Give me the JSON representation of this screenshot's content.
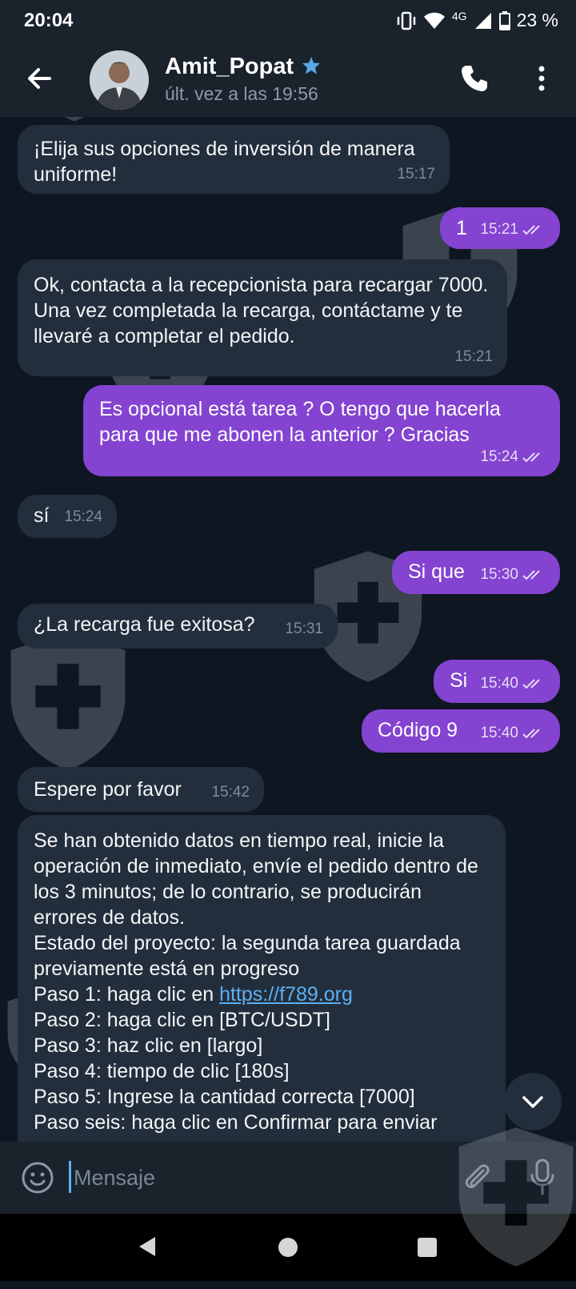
{
  "status_bar": {
    "time": "20:04",
    "network": "4G",
    "battery": "23 %"
  },
  "header": {
    "contact_name": "Amit_Popat",
    "last_seen": "últ. vez a las 19:56"
  },
  "messages": [
    {
      "dir": "in",
      "text": "¡Elija sus opciones de inversión de manera uniforme!",
      "time": "15:17"
    },
    {
      "dir": "out",
      "text": "1",
      "time": "15:21",
      "read": true
    },
    {
      "dir": "in",
      "text": "Ok, contacta a la recepcionista para recargar 7000. Una vez completada la recarga, contáctame y te llevaré a completar el pedido.",
      "time": "15:21"
    },
    {
      "dir": "out",
      "text": "Es opcional está tarea ? O tengo que hacerla para que me abonen la anterior ? Gracias",
      "time": "15:24",
      "read": true
    },
    {
      "dir": "in",
      "text": "sí",
      "time": "15:24"
    },
    {
      "dir": "out",
      "text": "Si que",
      "time": "15:30",
      "read": true
    },
    {
      "dir": "in",
      "text": "¿La recarga fue exitosa?",
      "time": "15:31"
    },
    {
      "dir": "out",
      "text": "Si",
      "time": "15:40",
      "read": true
    },
    {
      "dir": "out",
      "text": "Código 9",
      "time": "15:40",
      "read": true
    },
    {
      "dir": "in",
      "text": "Espere por favor",
      "time": "15:42"
    },
    {
      "dir": "in",
      "text_before_link": "Se han obtenido datos en tiempo real, inicie la operación de inmediato, envíe el pedido dentro de los 3 minutos; de lo contrario, se producirán errores de datos.\nEstado del proyecto: la segunda tarea guardada previamente está en progreso\nPaso 1: haga clic en ",
      "link": "https://f789.org",
      "text_after_link": "\nPaso 2: haga clic en [BTC/USDT]\nPaso 3: haz clic en [largo]\nPaso 4: tiempo de clic [180s]\nPaso 5: Ingrese la cantidad correcta [7000]\nPaso seis: haga clic en Confirmar para enviar"
    }
  ],
  "composer": {
    "placeholder": "Mensaje"
  },
  "icons": {
    "back": "arrow-left-icon",
    "verified": "star-icon",
    "call": "phone-icon",
    "menu": "more-vert-icon",
    "emoji": "smiley-icon",
    "attach": "paperclip-icon",
    "mic": "microphone-icon",
    "scroll": "chevron-down-icon"
  },
  "colors": {
    "background": "#0e1621",
    "incoming_bubble": "#232e3c",
    "outgoing_bubble": "#8443d0",
    "link": "#5cb0f2",
    "verified_star": "#5aa6e8"
  }
}
